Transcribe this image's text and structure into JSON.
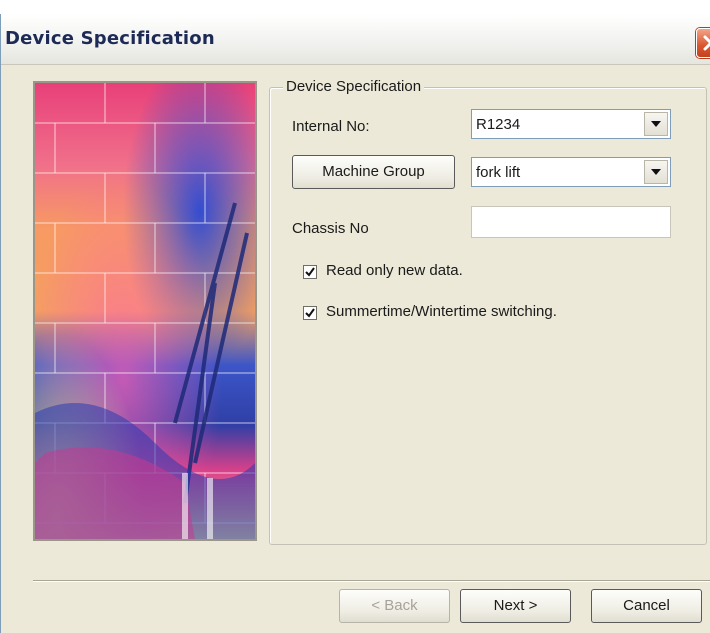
{
  "window": {
    "title": "Device Specification"
  },
  "group": {
    "title": "Device Specification"
  },
  "fields": {
    "internal_no": {
      "label": "Internal No:",
      "value": "R1234"
    },
    "machine_group": {
      "button_label": "Machine Group",
      "value": "fork lift"
    },
    "chassis_no": {
      "label": "Chassis No",
      "value": ""
    }
  },
  "checkboxes": [
    {
      "label": "Read only new data.",
      "checked": true
    },
    {
      "label": "Summertime/Wintertime switching.",
      "checked": true
    }
  ],
  "buttons": {
    "back": "< Back",
    "next": "Next >",
    "cancel": "Cancel"
  },
  "icons": {
    "close": "close-icon",
    "dropdown": "chevron-down-icon",
    "check": "checkmark-icon"
  },
  "colors": {
    "face": "#ece9d8",
    "close_button": "#d8562f",
    "title_text": "#1c2a55"
  }
}
